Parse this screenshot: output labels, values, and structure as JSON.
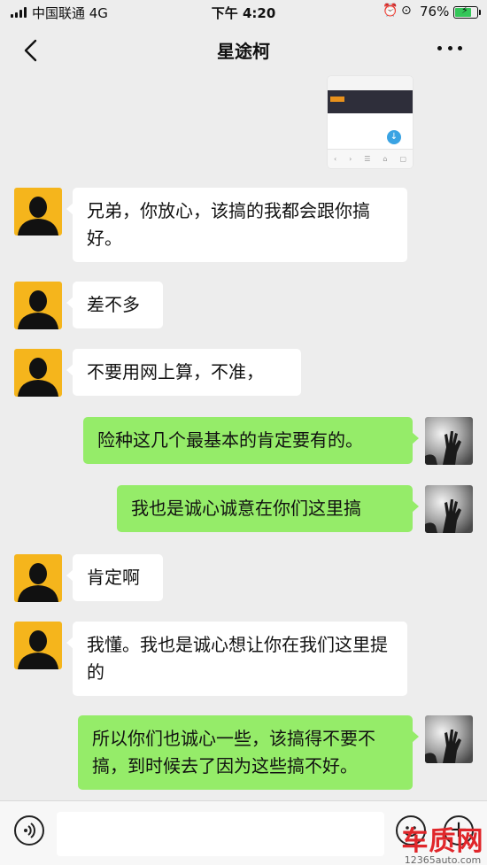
{
  "status_bar": {
    "carrier": "中国联通 4G",
    "time": "下午 4:20",
    "battery": "76%",
    "battery_level": 0.76
  },
  "nav": {
    "title": "星途柯",
    "back_icon": "chevron-left-icon",
    "more_icon": "more-dots-icon"
  },
  "shared_image": {
    "description_icon": "download-icon"
  },
  "messages": [
    {
      "side": "left",
      "text": "兄弟，你放心，该搞的我都会跟你搞好。"
    },
    {
      "side": "left",
      "text": "差不多"
    },
    {
      "side": "left",
      "text": "不要用网上算，不准，"
    },
    {
      "side": "right",
      "text": "险种这几个最基本的肯定要有的。"
    },
    {
      "side": "right",
      "text": "我也是诚心诚意在你们这里搞"
    },
    {
      "side": "left",
      "text": "肯定啊"
    },
    {
      "side": "left",
      "text": "我懂。我也是诚心想让你在我们这里提的"
    },
    {
      "side": "right",
      "text": "所以你们也诚心一些，该搞得不要不搞，到时候去了因为这些搞不好。"
    }
  ],
  "input_bar": {
    "placeholder": "",
    "voice_icon": "voice-icon",
    "emoji_icon": "emoji-icon",
    "plus_icon": "plus-icon"
  },
  "watermark": {
    "line1": "车质网",
    "line2": "12365auto.com"
  },
  "colors": {
    "background": "#ededed",
    "sent_bubble": "#95ec69",
    "received_bubble": "#ffffff",
    "contact_avatar_bg": "#f5b51c",
    "watermark_red": "#e0262a"
  }
}
